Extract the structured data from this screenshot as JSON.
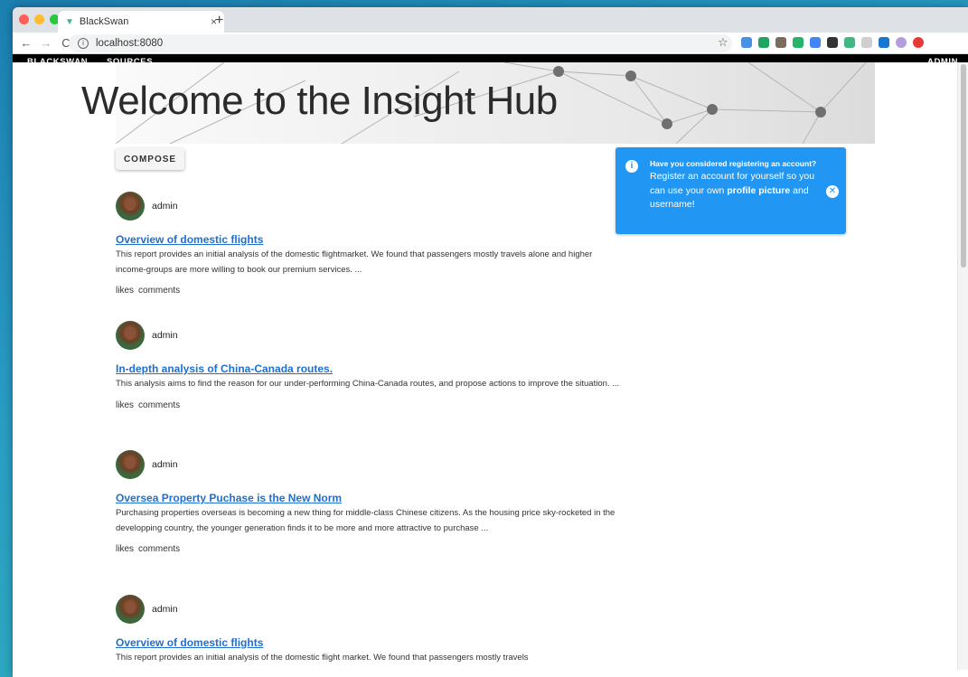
{
  "browser": {
    "tab_title": "BlackSwan",
    "tab_close": "×",
    "new_tab": "+",
    "back": "←",
    "forward": "→",
    "reload": "C",
    "url": "localhost:8080",
    "bookmark": "☆",
    "extension_colors": [
      "#4a8fe2",
      "#1fa463",
      "#7a6b5d",
      "#26b36b",
      "#4285f4",
      "#333333",
      "#41b883",
      "#cfcfcf",
      "#1976d2",
      "#b39ddb",
      "#e53935"
    ]
  },
  "appnav": {
    "brand": "BLACKSWAN",
    "sources": "SOURCES",
    "admin": "ADMIN"
  },
  "hero": {
    "title": "Welcome to the Insight Hub"
  },
  "compose_label": "COMPOSE",
  "alert": {
    "icon": "i",
    "heading": "Have you considered registering an account?",
    "body_1": "Register an account for yourself so you can use your own ",
    "body_bold": "profile picture",
    "body_2": " and username!",
    "close": "✕"
  },
  "posts": [
    {
      "author": "admin",
      "title": "Overview of domestic flights",
      "body": "This report provides an initial analysis of the domestic flightmarket. We found that passengers mostly travels alone and higher income-groups are more willing to book our premium services. ...",
      "likes": "likes",
      "comments": "comments"
    },
    {
      "author": "admin",
      "title": "In-depth analysis of China-Canada routes.",
      "body": "This analysis aims to find the reason for our under-performing China-Canada routes, and propose actions to improve the situation. ...",
      "likes": "likes",
      "comments": "comments"
    },
    {
      "author": "admin",
      "title": "Oversea Property Puchase is the New Norm",
      "body": "Purchasing properties overseas is becoming a new thing for middle-class Chinese citizens. As the housing price sky-rocketed in the developping country, the younger generation finds it to be more and more attractive to purchase ...",
      "likes": "likes",
      "comments": "comments"
    },
    {
      "author": "admin",
      "title": "Overview of domestic flights",
      "body": "This report provides an initial analysis of the domestic flight market. We found that passengers mostly travels",
      "likes": "likes",
      "comments": "comments"
    }
  ],
  "colors": {
    "accent": "#2196f3",
    "link": "#1e6fd0",
    "nav_bg": "#000000"
  }
}
